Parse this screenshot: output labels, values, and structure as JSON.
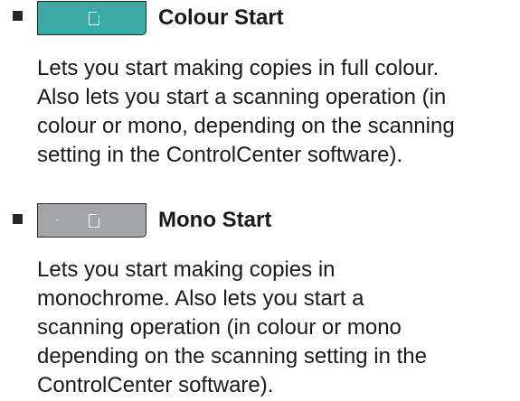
{
  "items": [
    {
      "title": "Colour Start",
      "button_color": "#3aa9a3",
      "icon": "copy-page-icon",
      "description_lines": [
        "Lets you start making copies in full colour.",
        "Also lets you start a scanning operation (in",
        "colour or mono, depending on the scanning",
        "setting in the ControlCenter software)."
      ]
    },
    {
      "title": "Mono Start",
      "button_color": "#a3a5a8",
      "icon": "copy-page-icon",
      "description_lines": [
        "Lets you start making copies in",
        "monochrome. Also lets you start a",
        "scanning operation (in colour or mono",
        "depending on the scanning setting in the",
        "ControlCenter software)."
      ]
    }
  ]
}
